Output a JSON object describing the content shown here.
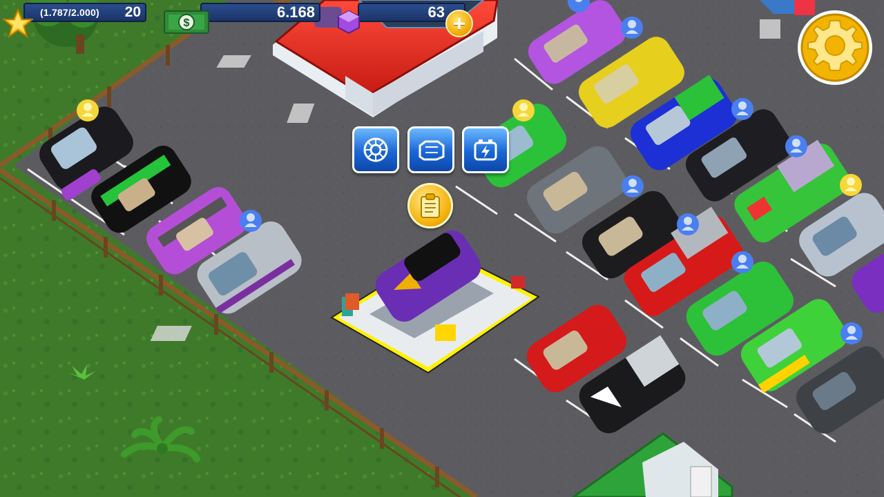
{
  "hud": {
    "xp_text": "(1.787/2.000)",
    "level": "20",
    "cash": "6.168",
    "gems": "63",
    "plus_symbol": "+"
  },
  "icons": {
    "xp": "star-icon",
    "cash": "cash-icon",
    "gems": "gem-icon",
    "settings": "gear-icon",
    "action_1": "wheel-icon",
    "action_2": "engine-icon",
    "action_3": "battery-icon",
    "task": "clipboard-icon",
    "customer": "customer-icon"
  },
  "colors": {
    "asphalt": "#5a5a5e",
    "grass": "#3f7a2a",
    "hud_blue": "#1b3468",
    "gold": "#f4b20a",
    "button_blue": "#1a66d6"
  }
}
